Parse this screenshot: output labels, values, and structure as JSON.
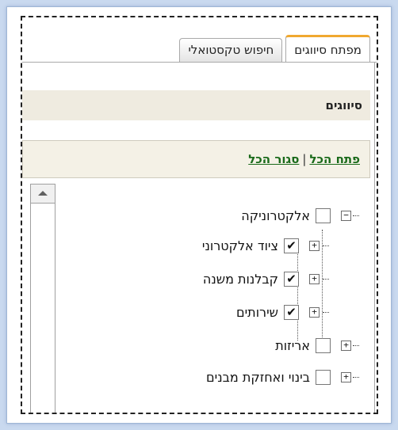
{
  "tabs": [
    {
      "label": "מפתח סיווגים",
      "active": true
    },
    {
      "label": "חיפוש טקסטואלי",
      "active": false
    }
  ],
  "section": {
    "title": "סיווגים"
  },
  "links": {
    "expand_all": "פתח הכל",
    "separator": "|",
    "collapse_all": "סגור הכל"
  },
  "tree": [
    {
      "label": "אלקטרוניקה",
      "checked": false,
      "expanded": true,
      "level": 0
    },
    {
      "label": "ציוד אלקטרוני",
      "checked": true,
      "expanded": false,
      "level": 1
    },
    {
      "label": "קבלנות משנה",
      "checked": true,
      "expanded": false,
      "level": 1
    },
    {
      "label": "שירותים",
      "checked": true,
      "expanded": false,
      "level": 1
    },
    {
      "label": "אריזות",
      "checked": false,
      "expanded": false,
      "level": 0
    },
    {
      "label": "בינוי ואחזקת מבנים",
      "checked": false,
      "expanded": false,
      "level": 0
    }
  ],
  "colors": {
    "tab_accent": "#f0a830",
    "link": "#1a6a1a",
    "header_bg": "#efebe0",
    "background": "#c9d9ef"
  }
}
